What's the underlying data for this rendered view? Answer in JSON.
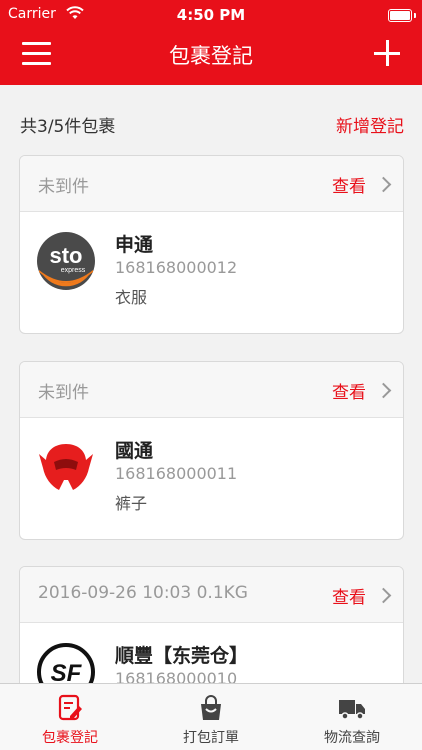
{
  "status_bar": {
    "carrier": "Carrier",
    "time": "4:50 PM"
  },
  "nav": {
    "title": "包裹登記",
    "menu_icon": "hamburger-menu-icon",
    "add_icon": "plus-icon"
  },
  "summary": {
    "count_text": "共3/5件包裹",
    "new_registration": "新增登記"
  },
  "packages": [
    {
      "status": "未到件",
      "view_label": "查看",
      "carrier_name": "申通",
      "tracking": "168168000012",
      "item": "衣服",
      "logo": "sto-express-logo"
    },
    {
      "status": "未到件",
      "view_label": "查看",
      "carrier_name": "國通",
      "tracking": "168168000011",
      "item": "裤子",
      "logo": "guotong-logo"
    },
    {
      "status": "2016-09-26 10:03 0.1KG",
      "view_label": "查看",
      "carrier_name": "順豐【东莞仓】",
      "tracking": "168168000010",
      "item": "",
      "logo": "sf-express-logo"
    }
  ],
  "tabs": [
    {
      "label": "包裹登記",
      "icon": "register-edit-icon",
      "active": true
    },
    {
      "label": "打包訂單",
      "icon": "shopping-bag-icon",
      "active": false
    },
    {
      "label": "物流查詢",
      "icon": "delivery-truck-icon",
      "active": false
    }
  ],
  "colors": {
    "brand_red": "#e8101a",
    "background": "#f2f2f2"
  }
}
